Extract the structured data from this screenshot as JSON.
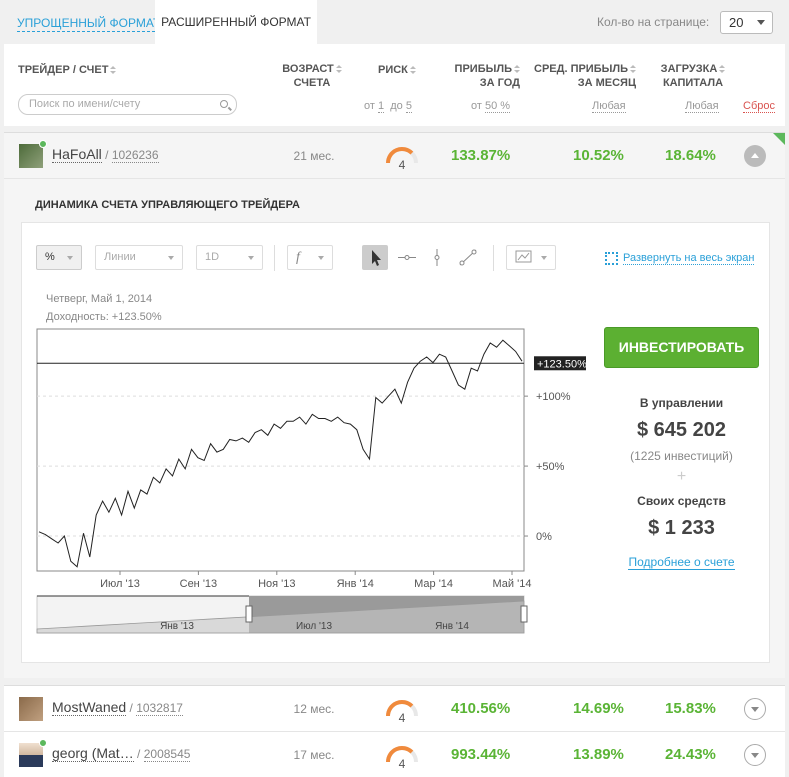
{
  "tabs": {
    "simple": "УПРОЩЕННЫЙ ФОРМАТ",
    "extended": "РАСШИРЕННЫЙ ФОРМАТ"
  },
  "per_page": {
    "label": "Кол-во на странице:",
    "value": "20"
  },
  "columns": {
    "trader": "ТРЕЙДЕР / СЧЕТ",
    "age_line1": "ВОЗРАСТ",
    "age_line2": "СЧЕТА",
    "risk": "РИСК",
    "profit_year_line1": "ПРИБЫЛЬ",
    "profit_year_line2": "ЗА ГОД",
    "avg_profit_line1": "СРЕД. ПРИБЫЛЬ",
    "avg_profit_line2": "ЗА МЕСЯЦ",
    "load_line1": "ЗАГРУЗКА",
    "load_line2": "КАПИТАЛА"
  },
  "filters": {
    "search_placeholder": "Поиск по имени/счету",
    "risk_from_label": "от",
    "risk_from": "1",
    "risk_to_label": "до",
    "risk_to": "5",
    "profit_from_label": "от",
    "profit_from": "50 %",
    "avg_profit": "Любая",
    "load": "Любая",
    "reset": "Сброс"
  },
  "traders": [
    {
      "name": "HaFoAll",
      "sep": " / ",
      "account": "1026236",
      "age": "21 мес.",
      "risk": "4",
      "risk_level": 4,
      "profit_year": "133.87%",
      "avg_profit": "10.52%",
      "load": "18.64%",
      "expanded": true,
      "online": true
    },
    {
      "name": "MostWaned",
      "sep": " / ",
      "account": "1032817",
      "age": "12 мес.",
      "risk": "4",
      "risk_level": 4,
      "profit_year": "410.56%",
      "avg_profit": "14.69%",
      "load": "15.83%",
      "expanded": false,
      "online": false
    },
    {
      "name": "georg (Mat…",
      "sep": " / ",
      "account": "2008545",
      "age": "17 мес.",
      "risk": "4",
      "risk_level": 4,
      "profit_year": "993.44%",
      "avg_profit": "13.89%",
      "load": "24.43%",
      "expanded": false,
      "online": true
    }
  ],
  "panel": {
    "title": "ДИНАМИКА СЧЕТА УПРАВЛЯЮЩЕГО ТРЕЙДЕРА",
    "toolbar": {
      "unit": "%",
      "chart_style": "Линии",
      "period": "1D",
      "func": "f",
      "fullscreen": "Развернуть на весь экран"
    },
    "info_date": "Четверг, Май 1, 2014",
    "info_yield": "Доходность: +123.50%",
    "invest_button": "ИНВЕСТИРОВАТЬ",
    "managed_label": "В управлении",
    "managed_value": "$ 645 202",
    "investments_count": "(1225 инвестиций)",
    "plus": "+",
    "own_label": "Своих средств",
    "own_value": "$ 1 233",
    "details_link": "Подробнее о счете"
  },
  "colors": {
    "accent_blue": "#2aa0d8",
    "green": "#5ab435",
    "invest_green": "#5cb032",
    "gauge_orange": "#f08a3c"
  },
  "chart_data": {
    "type": "line",
    "x_labels": [
      "Июл '13",
      "Сен '13",
      "Ноя '13",
      "Янв '14",
      "Мар '14",
      "Май '14"
    ],
    "y_ticks": [
      "0%",
      "+50%",
      "+100%"
    ],
    "y_tick_values": [
      0,
      50,
      100
    ],
    "current_label": "+123.50%",
    "current_value": 123.5,
    "ylim": [
      -25,
      148
    ],
    "navigator_labels": [
      "Янв '13",
      "Июл '13",
      "Янв '14"
    ],
    "series": [
      {
        "values": [
          3,
          1,
          -2,
          -5,
          0,
          -18,
          -22,
          2,
          -15,
          15,
          25,
          17,
          27,
          15,
          32,
          20,
          33,
          30,
          42,
          38,
          48,
          43,
          55,
          48,
          62,
          56,
          54,
          66,
          60,
          62,
          69,
          68,
          70,
          67,
          74,
          76,
          72,
          80,
          77,
          82,
          82,
          85,
          80,
          87,
          84,
          84,
          82,
          85,
          81,
          80,
          76,
          62,
          55,
          99,
          95,
          100,
          105,
          95,
          110,
          120,
          125,
          128,
          124,
          130,
          128,
          118,
          108,
          105,
          120,
          118,
          130,
          138,
          135,
          140,
          136,
          132,
          125
        ]
      }
    ]
  }
}
